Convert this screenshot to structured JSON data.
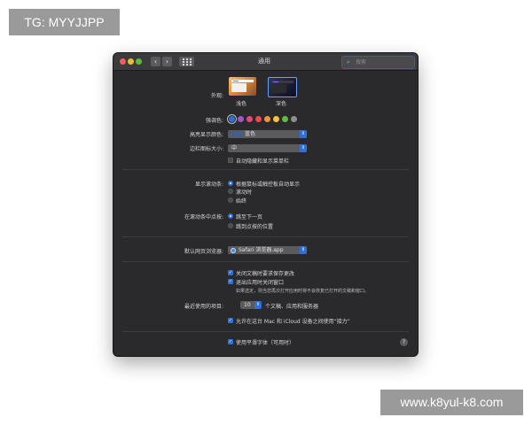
{
  "watermarks": {
    "top_left": "TG: MYYJJPP",
    "bottom_right": "www.k8yul-k8.com"
  },
  "window": {
    "title": "通用",
    "search_placeholder": "搜索",
    "icons": {
      "back": "chevron-left-icon",
      "forward": "chevron-right-icon",
      "show_all": "grid-icon",
      "search": "magnifier-icon",
      "help": "question-icon"
    }
  },
  "appearance": {
    "label": "外观:",
    "options": [
      {
        "name": "浅色",
        "selected": false
      },
      {
        "name": "深色",
        "selected": true
      }
    ]
  },
  "accent": {
    "label": "强调色:",
    "colors": [
      "#2f6fd6",
      "#9b57c9",
      "#e5467b",
      "#ea4b4b",
      "#f0933a",
      "#f4c33d",
      "#62b946",
      "#8e8e93"
    ],
    "selected_index": 0
  },
  "highlight": {
    "label": "高亮显示颜色:",
    "value": "蓝色",
    "swatch_color": "#3d5f9c"
  },
  "sidebar_icon_size": {
    "label": "边栏图标大小:",
    "value": "中"
  },
  "auto_hide_menubar": {
    "label": "自动隐藏和显示菜单栏",
    "checked": false
  },
  "show_scroll_bars": {
    "label": "显示滚动条:",
    "options": [
      "根据鼠标或触控板自动显示",
      "滚动时",
      "始终"
    ],
    "selected_index": 0
  },
  "click_scroll_bar": {
    "label": "在滚动条中点按:",
    "options": [
      "跳至下一页",
      "跳到点按的位置"
    ],
    "selected_index": 0
  },
  "default_browser": {
    "label": "默认网页浏览器:",
    "value": "Safari 浏览器.app"
  },
  "ask_keep_changes": {
    "label": "关闭文稿时要求保存更改",
    "checked": true
  },
  "close_windows_on_quit": {
    "label": "退出应用时关闭窗口",
    "checked": true,
    "note": "如果选定，则当您再次打开应用时将不会恢复已打开的文稿和窗口。"
  },
  "recent_items": {
    "label": "最近使用的项目:",
    "value": "10",
    "suffix": "个文稿、应用和服务器"
  },
  "handoff": {
    "label": "允许在这台 Mac 和 iCloud 设备之间使用“接力”",
    "checked": true
  },
  "font_smoothing": {
    "label": "使用平滑字体（可用时）",
    "checked": true
  }
}
